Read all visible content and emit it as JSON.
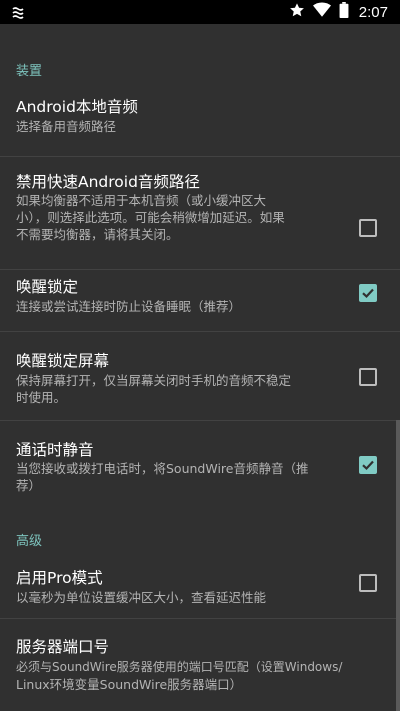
{
  "status_bar": {
    "time": "2:07",
    "icons": [
      "notification-icon",
      "star-icon",
      "wifi-icon",
      "battery-icon"
    ]
  },
  "sections": {
    "device": {
      "header": "装置"
    },
    "advanced": {
      "header": "高级"
    }
  },
  "prefs": {
    "local_audio": {
      "title": "Android本地音频",
      "summary": "选择备用音频路径"
    },
    "disable_fast_path": {
      "title": "禁用快速Android音频路径",
      "summary_lines": [
        "如果均衡器不适用于本机音频（或小缓冲区大",
        "小），则选择此选项。可能会稍微增加延迟。如果",
        "不需要均衡器，请将其关闭。"
      ],
      "checked": false
    },
    "wake_lock": {
      "title": "唤醒锁定",
      "summary": "连接或尝试连接时防止设备睡眠（推荐）",
      "checked": true
    },
    "wake_lock_screen": {
      "title": "唤醒锁定屏幕",
      "summary_lines": [
        "保持屏幕打开，仅当屏幕关闭时手机的音频不稳定",
        "时使用。"
      ],
      "checked": false
    },
    "mute_on_call": {
      "title": "通话时静音",
      "summary_lines": [
        "当您接收或拨打电话时，将SoundWire音频静音（推",
        "荐）"
      ],
      "checked": true
    },
    "pro_mode": {
      "title": "启用Pro模式",
      "summary": "以毫秒为单位设置缓冲区大小，查看延迟性能",
      "checked": false
    },
    "server_port": {
      "title": "服务器端口号",
      "summary_lines": [
        "必须与SoundWire服务器使用的端口号匹配（设置Windows/",
        "Linux环境变量SoundWire服务器端口）"
      ]
    }
  },
  "colors": {
    "accent": "#80cbc4",
    "section_header": "#7dc3bd",
    "background": "#303030",
    "status_bar": "#000000"
  }
}
